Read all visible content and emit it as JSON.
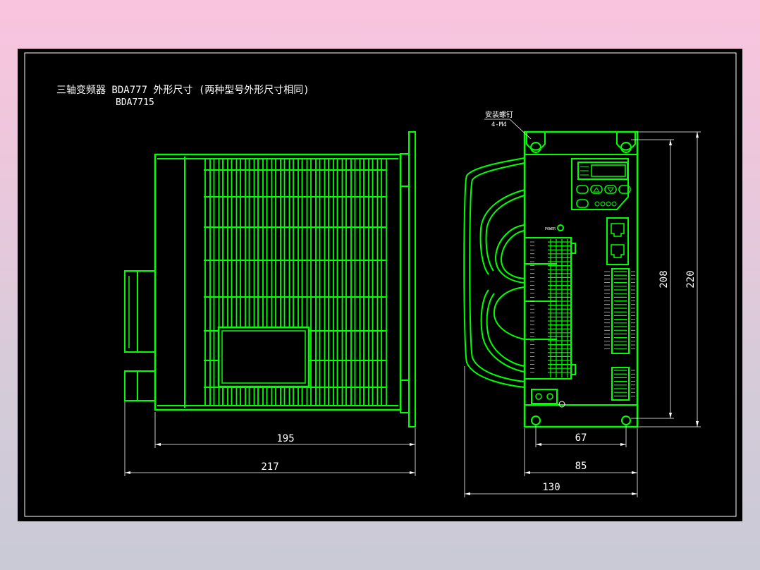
{
  "drawing": {
    "title_line1": "三轴变频器 BDA777  外形尺寸 (两种型号外形尺寸相同)",
    "title_line2": "BDA7715",
    "mount_note_line1": "安装螺钉",
    "mount_note_line2": "4-M4",
    "power_label": "POWER"
  },
  "dimensions": {
    "side_inner_width": "195",
    "side_total_width": "217",
    "front_hole_spacing": "67",
    "front_body_width": "85",
    "front_total_width": "130",
    "front_hole_height": "208",
    "front_total_height": "220"
  },
  "colors": {
    "background": "#000000",
    "lines": "#00ff00",
    "dimensions": "#ffffff"
  }
}
